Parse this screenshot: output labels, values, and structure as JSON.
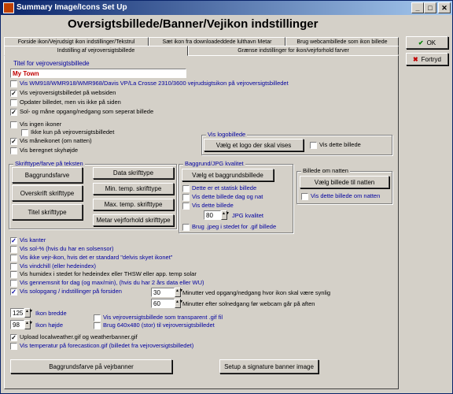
{
  "window": {
    "title": "Summary Image/Icons Set Up"
  },
  "heading": "Oversigtsbillede/Banner/Vejikon indstillinger",
  "tabs_row1": [
    "Forside ikon/Vejrudsigt ikon indstillinger/Tekstrul",
    "Sæt ikon fra downloadeddede lulthavn Metar",
    "Brug webcambillede som ikon billede"
  ],
  "tabs_row2": [
    "Indstilling af vejroversigtsbillede",
    "Grænse indstillinger for ikon/vejrforhold farver"
  ],
  "buttons": {
    "ok": "OK",
    "cancel": "Fortryd"
  },
  "title_section": {
    "label": "Titel for vejroversigtsbillede",
    "value": "My Town"
  },
  "checks_top": [
    {
      "label": "Vis WM918/WMR918/WMR968/Davis VP/La Crosse 2310/3600 vejrudsigtsikon på vejroversigtsbilledet",
      "checked": false,
      "blue": true
    },
    {
      "label": "Vis vejroversigtsbilledet på websiden",
      "checked": true,
      "blue": false
    },
    {
      "label": "Opdater billedet, men vis ikke på siden",
      "checked": false,
      "blue": false
    },
    {
      "label": "Sol- og måne opgang/nedgang som seperat billede",
      "checked": true,
      "blue": false
    }
  ],
  "checks_mid": [
    {
      "label": "Vis ingen ikoner",
      "checked": false,
      "blue": false
    },
    {
      "label": "Ikke kun på vejroversigtsbilledet",
      "checked": false,
      "blue": false
    },
    {
      "label": "Vis måneikonet (om natten)",
      "checked": true,
      "blue": false
    },
    {
      "label": "Vis beregnet skyhøjde",
      "checked": false,
      "blue": false
    }
  ],
  "logo_group": {
    "label": "Vis logobillede",
    "button": "Vælg et logo der skal vises",
    "check": "Vis dette billede"
  },
  "font_group": {
    "label": "Skrifttype/farve på teksten",
    "buttons": [
      "Baggrundsfarve",
      "Data skrifttype",
      "Overskrift skrifttype",
      "Min. temp. skrifttype",
      "Max. temp. skrifttype",
      "Titel skrifttype",
      "Metar vejrforhold skrifttype"
    ]
  },
  "bg_group": {
    "label": "Baggrund/JPG kvalitet",
    "button": "Vælg et baggrundsbillede",
    "checks": [
      "Dette er et statisk billede",
      "Vis dette billede dag og nat",
      "Vis dette billede"
    ],
    "jpg_value": "80",
    "jpg_label": "JPG kvalitet",
    "gif_check": "Brug .jpeg i stedet for .gif billede"
  },
  "night_group": {
    "label": "Billede om natten",
    "button": "Vælg billede til natten",
    "check": "Vis dette billede om natten"
  },
  "checks_bottom": [
    {
      "label": "Vis kanter",
      "checked": true,
      "blue": true
    },
    {
      "label": "Vis sol-% (hvis du har en solsensor)",
      "checked": false,
      "blue": true
    },
    {
      "label": "Vis ikke vejr-ikon, hvis det er standard \"delvis skyet ikonet\"",
      "checked": false,
      "blue": true
    },
    {
      "label": "Vis vindchill (eller hedeindex)",
      "checked": false,
      "blue": true
    },
    {
      "label": "Vis humidex i stedet for hedeindex eller THSW eller app. temp solar",
      "checked": false,
      "blue": false
    },
    {
      "label": "Vis gennemsnit for dag (og max/min), (hvis du har 2 års data eller WU)",
      "checked": false,
      "blue": true
    },
    {
      "label": "Vis solopgang / indstillinger på forsiden",
      "checked": true,
      "blue": true
    }
  ],
  "minutes": [
    {
      "value": "30",
      "label": "Minutter ved opgang/nedgang hvor ikon skal være synlig"
    },
    {
      "value": "60",
      "label": "Minutter efter solnedgang før webcam går på aften"
    }
  ],
  "icon_size": [
    {
      "value": "125",
      "label": "Ikon bredde"
    },
    {
      "value": "98",
      "label": "Ikon højde"
    }
  ],
  "size_checks": [
    "Vis vejroversigtsbillede som transparent .gif fil",
    "Brug 640x480 (stor) til vejroversigtsbilledet"
  ],
  "upload_checks": [
    {
      "label": "Upload localweather.gif og weatherbanner.gif",
      "checked": true
    },
    {
      "label": "Vis temperatur på forecasticon.gif (billedet fra vejroversigtsbilledet)",
      "checked": false
    }
  ],
  "bottom_buttons": {
    "banner_bg": "Baggrundsfarve på vejrbanner",
    "signature": "Setup a signature banner image"
  }
}
